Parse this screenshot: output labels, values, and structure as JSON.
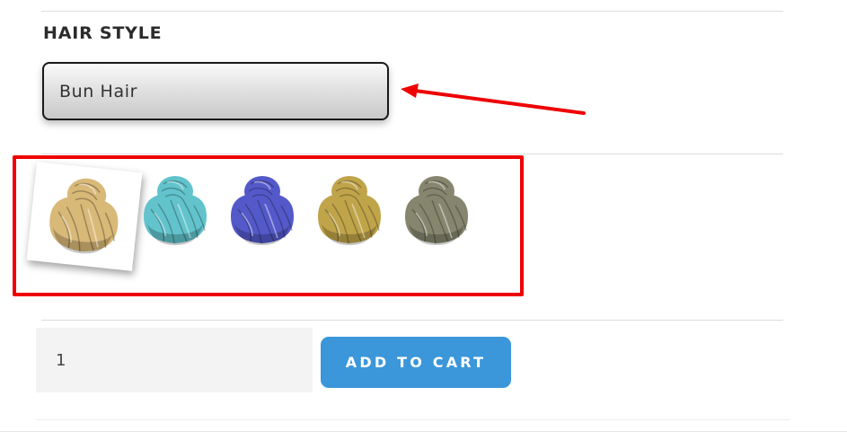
{
  "hair_style": {
    "label": "HAIR STYLE",
    "selected_value": "Bun Hair"
  },
  "swatches": [
    {
      "icon": "bun-hair-blonde-icon",
      "color": "#d9b978",
      "selected": true
    },
    {
      "icon": "bun-hair-teal-icon",
      "color": "#62c3cc",
      "selected": false
    },
    {
      "icon": "bun-hair-blue-icon",
      "color": "#5459c9",
      "selected": false
    },
    {
      "icon": "bun-hair-olive-icon",
      "color": "#c0a44a",
      "selected": false
    },
    {
      "icon": "bun-hair-gray-icon",
      "color": "#86866f",
      "selected": false
    }
  ],
  "purchase": {
    "quantity": "1",
    "add_to_cart_label": "ADD TO CART"
  },
  "colors": {
    "annotation_red": "#ee0000",
    "button_blue": "#3b97da"
  }
}
